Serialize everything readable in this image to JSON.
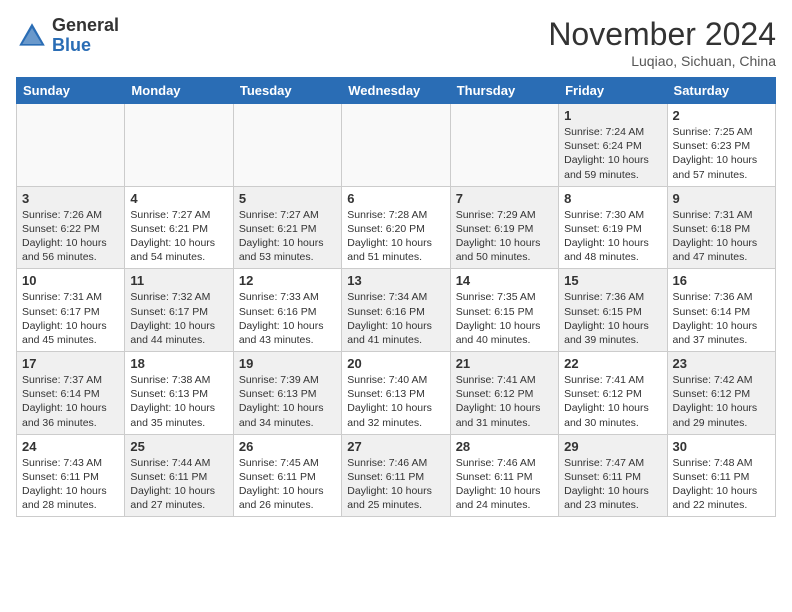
{
  "header": {
    "logo_general": "General",
    "logo_blue": "Blue",
    "month_title": "November 2024",
    "subtitle": "Luqiao, Sichuan, China"
  },
  "weekdays": [
    "Sunday",
    "Monday",
    "Tuesday",
    "Wednesday",
    "Thursday",
    "Friday",
    "Saturday"
  ],
  "weeks": [
    [
      {
        "day": "",
        "info": "",
        "shaded": false,
        "empty": true
      },
      {
        "day": "",
        "info": "",
        "shaded": false,
        "empty": true
      },
      {
        "day": "",
        "info": "",
        "shaded": false,
        "empty": true
      },
      {
        "day": "",
        "info": "",
        "shaded": false,
        "empty": true
      },
      {
        "day": "",
        "info": "",
        "shaded": false,
        "empty": true
      },
      {
        "day": "1",
        "info": "Sunrise: 7:24 AM\nSunset: 6:24 PM\nDaylight: 10 hours and 59 minutes.",
        "shaded": true,
        "empty": false
      },
      {
        "day": "2",
        "info": "Sunrise: 7:25 AM\nSunset: 6:23 PM\nDaylight: 10 hours and 57 minutes.",
        "shaded": false,
        "empty": false
      }
    ],
    [
      {
        "day": "3",
        "info": "Sunrise: 7:26 AM\nSunset: 6:22 PM\nDaylight: 10 hours and 56 minutes.",
        "shaded": true,
        "empty": false
      },
      {
        "day": "4",
        "info": "Sunrise: 7:27 AM\nSunset: 6:21 PM\nDaylight: 10 hours and 54 minutes.",
        "shaded": false,
        "empty": false
      },
      {
        "day": "5",
        "info": "Sunrise: 7:27 AM\nSunset: 6:21 PM\nDaylight: 10 hours and 53 minutes.",
        "shaded": true,
        "empty": false
      },
      {
        "day": "6",
        "info": "Sunrise: 7:28 AM\nSunset: 6:20 PM\nDaylight: 10 hours and 51 minutes.",
        "shaded": false,
        "empty": false
      },
      {
        "day": "7",
        "info": "Sunrise: 7:29 AM\nSunset: 6:19 PM\nDaylight: 10 hours and 50 minutes.",
        "shaded": true,
        "empty": false
      },
      {
        "day": "8",
        "info": "Sunrise: 7:30 AM\nSunset: 6:19 PM\nDaylight: 10 hours and 48 minutes.",
        "shaded": false,
        "empty": false
      },
      {
        "day": "9",
        "info": "Sunrise: 7:31 AM\nSunset: 6:18 PM\nDaylight: 10 hours and 47 minutes.",
        "shaded": true,
        "empty": false
      }
    ],
    [
      {
        "day": "10",
        "info": "Sunrise: 7:31 AM\nSunset: 6:17 PM\nDaylight: 10 hours and 45 minutes.",
        "shaded": false,
        "empty": false
      },
      {
        "day": "11",
        "info": "Sunrise: 7:32 AM\nSunset: 6:17 PM\nDaylight: 10 hours and 44 minutes.",
        "shaded": true,
        "empty": false
      },
      {
        "day": "12",
        "info": "Sunrise: 7:33 AM\nSunset: 6:16 PM\nDaylight: 10 hours and 43 minutes.",
        "shaded": false,
        "empty": false
      },
      {
        "day": "13",
        "info": "Sunrise: 7:34 AM\nSunset: 6:16 PM\nDaylight: 10 hours and 41 minutes.",
        "shaded": true,
        "empty": false
      },
      {
        "day": "14",
        "info": "Sunrise: 7:35 AM\nSunset: 6:15 PM\nDaylight: 10 hours and 40 minutes.",
        "shaded": false,
        "empty": false
      },
      {
        "day": "15",
        "info": "Sunrise: 7:36 AM\nSunset: 6:15 PM\nDaylight: 10 hours and 39 minutes.",
        "shaded": true,
        "empty": false
      },
      {
        "day": "16",
        "info": "Sunrise: 7:36 AM\nSunset: 6:14 PM\nDaylight: 10 hours and 37 minutes.",
        "shaded": false,
        "empty": false
      }
    ],
    [
      {
        "day": "17",
        "info": "Sunrise: 7:37 AM\nSunset: 6:14 PM\nDaylight: 10 hours and 36 minutes.",
        "shaded": true,
        "empty": false
      },
      {
        "day": "18",
        "info": "Sunrise: 7:38 AM\nSunset: 6:13 PM\nDaylight: 10 hours and 35 minutes.",
        "shaded": false,
        "empty": false
      },
      {
        "day": "19",
        "info": "Sunrise: 7:39 AM\nSunset: 6:13 PM\nDaylight: 10 hours and 34 minutes.",
        "shaded": true,
        "empty": false
      },
      {
        "day": "20",
        "info": "Sunrise: 7:40 AM\nSunset: 6:13 PM\nDaylight: 10 hours and 32 minutes.",
        "shaded": false,
        "empty": false
      },
      {
        "day": "21",
        "info": "Sunrise: 7:41 AM\nSunset: 6:12 PM\nDaylight: 10 hours and 31 minutes.",
        "shaded": true,
        "empty": false
      },
      {
        "day": "22",
        "info": "Sunrise: 7:41 AM\nSunset: 6:12 PM\nDaylight: 10 hours and 30 minutes.",
        "shaded": false,
        "empty": false
      },
      {
        "day": "23",
        "info": "Sunrise: 7:42 AM\nSunset: 6:12 PM\nDaylight: 10 hours and 29 minutes.",
        "shaded": true,
        "empty": false
      }
    ],
    [
      {
        "day": "24",
        "info": "Sunrise: 7:43 AM\nSunset: 6:11 PM\nDaylight: 10 hours and 28 minutes.",
        "shaded": false,
        "empty": false
      },
      {
        "day": "25",
        "info": "Sunrise: 7:44 AM\nSunset: 6:11 PM\nDaylight: 10 hours and 27 minutes.",
        "shaded": true,
        "empty": false
      },
      {
        "day": "26",
        "info": "Sunrise: 7:45 AM\nSunset: 6:11 PM\nDaylight: 10 hours and 26 minutes.",
        "shaded": false,
        "empty": false
      },
      {
        "day": "27",
        "info": "Sunrise: 7:46 AM\nSunset: 6:11 PM\nDaylight: 10 hours and 25 minutes.",
        "shaded": true,
        "empty": false
      },
      {
        "day": "28",
        "info": "Sunrise: 7:46 AM\nSunset: 6:11 PM\nDaylight: 10 hours and 24 minutes.",
        "shaded": false,
        "empty": false
      },
      {
        "day": "29",
        "info": "Sunrise: 7:47 AM\nSunset: 6:11 PM\nDaylight: 10 hours and 23 minutes.",
        "shaded": true,
        "empty": false
      },
      {
        "day": "30",
        "info": "Sunrise: 7:48 AM\nSunset: 6:11 PM\nDaylight: 10 hours and 22 minutes.",
        "shaded": false,
        "empty": false
      }
    ]
  ]
}
